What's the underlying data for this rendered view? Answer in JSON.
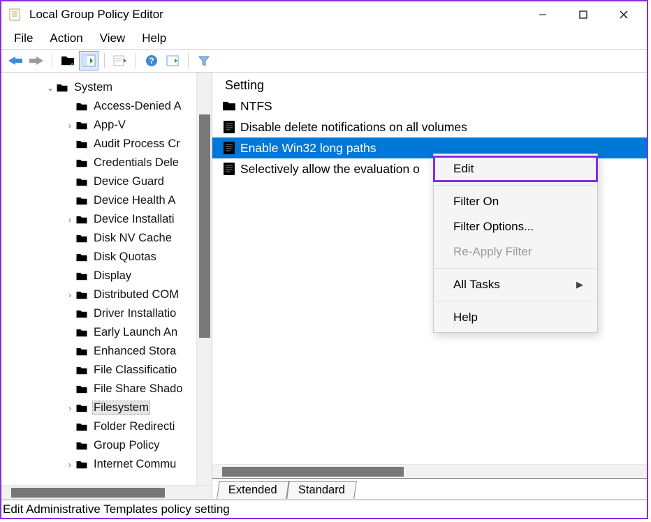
{
  "window": {
    "title": "Local Group Policy Editor"
  },
  "menubar": [
    "File",
    "Action",
    "View",
    "Help"
  ],
  "tree": {
    "root": {
      "label": "System",
      "expanded": true
    },
    "items": [
      {
        "label": "Access-Denied A",
        "exp": ""
      },
      {
        "label": "App-V",
        "exp": "›"
      },
      {
        "label": "Audit Process Cr",
        "exp": ""
      },
      {
        "label": "Credentials Dele",
        "exp": ""
      },
      {
        "label": "Device Guard",
        "exp": ""
      },
      {
        "label": "Device Health A",
        "exp": ""
      },
      {
        "label": "Device Installati",
        "exp": "›"
      },
      {
        "label": "Disk NV Cache",
        "exp": ""
      },
      {
        "label": "Disk Quotas",
        "exp": ""
      },
      {
        "label": "Display",
        "exp": ""
      },
      {
        "label": "Distributed COM",
        "exp": "›"
      },
      {
        "label": "Driver Installatio",
        "exp": ""
      },
      {
        "label": "Early Launch An",
        "exp": ""
      },
      {
        "label": "Enhanced Stora",
        "exp": ""
      },
      {
        "label": "File Classificatio",
        "exp": ""
      },
      {
        "label": "File Share Shado",
        "exp": ""
      },
      {
        "label": "Filesystem",
        "exp": "›",
        "selected": true
      },
      {
        "label": "Folder Redirecti",
        "exp": ""
      },
      {
        "label": "Group Policy",
        "exp": ""
      },
      {
        "label": "Internet Commu",
        "exp": "›"
      }
    ]
  },
  "list": {
    "header": "Setting",
    "rows": [
      {
        "type": "folder",
        "label": "NTFS"
      },
      {
        "type": "policy",
        "label": "Disable delete notifications on all volumes"
      },
      {
        "type": "policy",
        "label": "Enable Win32 long paths",
        "selected": true
      },
      {
        "type": "policy",
        "label": "Selectively allow the evaluation o"
      }
    ]
  },
  "tabs": {
    "left": "Extended",
    "right": "Standard"
  },
  "context_menu": {
    "items": [
      {
        "label": "Edit",
        "highlighted": true
      },
      {
        "sep": true
      },
      {
        "label": "Filter On"
      },
      {
        "label": "Filter Options..."
      },
      {
        "label": "Re-Apply Filter",
        "disabled": true
      },
      {
        "sep": true
      },
      {
        "label": "All Tasks",
        "submenu": true
      },
      {
        "sep": true
      },
      {
        "label": "Help"
      }
    ]
  },
  "status": "Edit Administrative Templates policy setting"
}
